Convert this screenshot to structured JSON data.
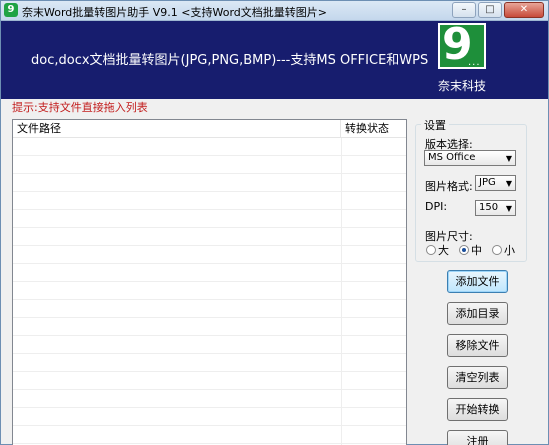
{
  "window": {
    "title": "奈末Word批量转图片助手 V9.1  <支持Word文档批量转图片>",
    "app_icon": "9",
    "buttons": [
      "–",
      "□",
      "✕"
    ]
  },
  "banner": {
    "text": "doc,docx文档批量转图片(JPG,PNG,BMP)---支持MS OFFICE和WPS",
    "logo_mark": "9",
    "logo_dots": "...",
    "company": "奈末科技"
  },
  "hint": "提示:支持文件直接拖入列表",
  "file_list": {
    "columns": [
      "文件路径",
      "转换状态"
    ],
    "rows": []
  },
  "settings": {
    "legend": "设置",
    "version_label": "版本选择:",
    "version_value": "MS Office",
    "format_label": "图片格式:",
    "format_value": "JPG",
    "dpi_label": "DPI:",
    "dpi_value": "150",
    "size_label": "图片尺寸:",
    "size_options": [
      "大",
      "中",
      "小"
    ],
    "size_selected": "中"
  },
  "actions": {
    "add_file": "添加文件",
    "add_dir": "添加目录",
    "remove_file": "移除文件",
    "clear_list": "清空列表",
    "start": "开始转换",
    "register": "注册"
  },
  "colors": {
    "banner": "#171d6e",
    "hint": "#c21c1c",
    "logo": "#1e8f3a"
  }
}
